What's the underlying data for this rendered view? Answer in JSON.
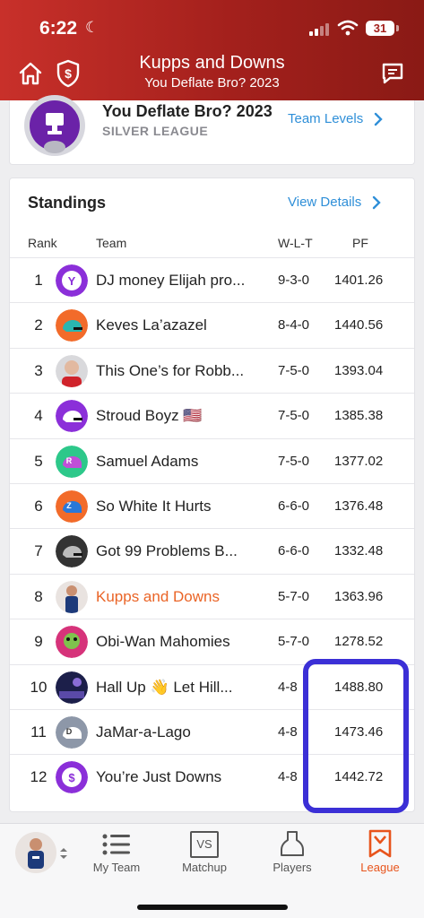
{
  "status": {
    "time": "6:22",
    "battery": "31"
  },
  "header": {
    "title": "Kupps and Downs",
    "subtitle": "You Deflate Bro? 2023"
  },
  "league": {
    "name": "You Deflate Bro? 2023",
    "level": "SILVER LEAGUE",
    "team_levels_label": "Team Levels"
  },
  "standings": {
    "title": "Standings",
    "view_details_label": "View Details",
    "columns": {
      "rank": "Rank",
      "team": "Team",
      "wlt": "W-L-T",
      "pf": "PF"
    },
    "rows": [
      {
        "rank": "1",
        "team": "DJ money Elijah pro...",
        "wlt": "9-3-0",
        "pf": "1401.26"
      },
      {
        "rank": "2",
        "team": "Keves La’azazel",
        "wlt": "8-4-0",
        "pf": "1440.56"
      },
      {
        "rank": "3",
        "team": "This One’s for Robb...",
        "wlt": "7-5-0",
        "pf": "1393.04"
      },
      {
        "rank": "4",
        "team": "Stroud Boyz 🇺🇸",
        "wlt": "7-5-0",
        "pf": "1385.38"
      },
      {
        "rank": "5",
        "team": "Samuel Adams",
        "wlt": "7-5-0",
        "pf": "1377.02"
      },
      {
        "rank": "6",
        "team": "So White It Hurts",
        "wlt": "6-6-0",
        "pf": "1376.48"
      },
      {
        "rank": "7",
        "team": "Got 99 Problems B...",
        "wlt": "6-6-0",
        "pf": "1332.48"
      },
      {
        "rank": "8",
        "team": "Kupps and Downs",
        "wlt": "5-7-0",
        "pf": "1363.96"
      },
      {
        "rank": "9",
        "team": "Obi-Wan Mahomies",
        "wlt": "5-7-0",
        "pf": "1278.52"
      },
      {
        "rank": "10",
        "team": "Hall Up 👋 Let Hill...",
        "wlt": "4-8",
        "pf": "1488.80"
      },
      {
        "rank": "11",
        "team": "JaMar-a-Lago",
        "wlt": "4-8",
        "pf": "1473.46"
      },
      {
        "rank": "12",
        "team": "You’re Just Downs",
        "wlt": "4-8",
        "pf": "1442.72"
      }
    ]
  },
  "tabs": {
    "my_team": "My Team",
    "matchup": "Matchup",
    "players": "Players",
    "league": "League",
    "vs": "VS"
  },
  "colors": {
    "header": "#b4251f",
    "link": "#2f8fd8",
    "accent": "#ea6426",
    "annotation": "#3b2fd6"
  }
}
